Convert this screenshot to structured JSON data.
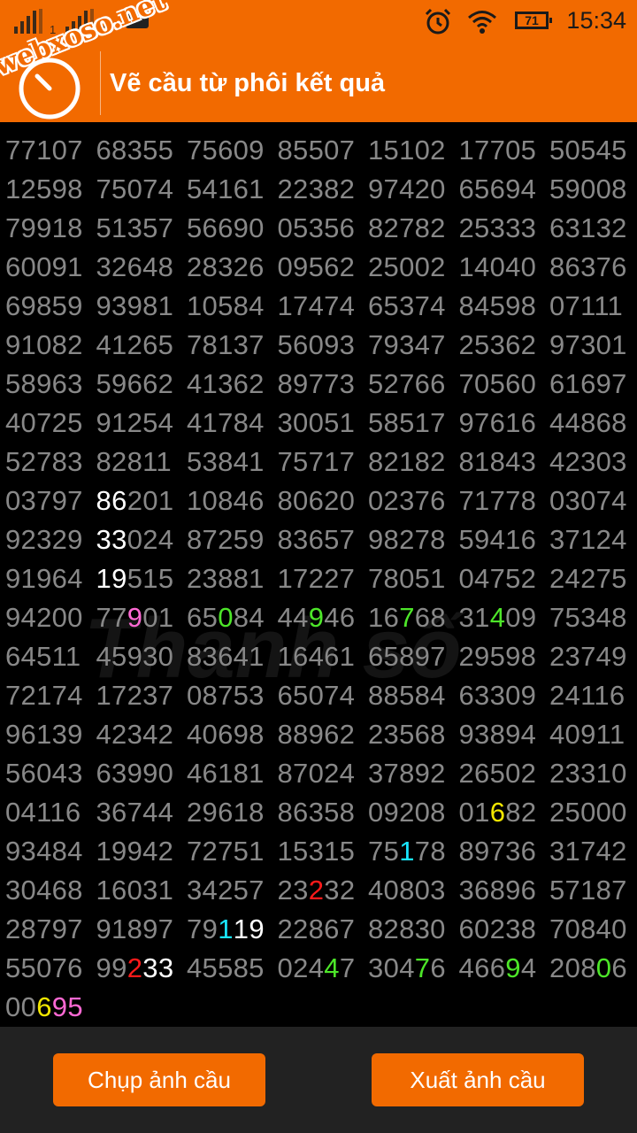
{
  "status_bar": {
    "sim1_label": "1",
    "sim2_label": "2",
    "battery": "71",
    "time": "15:34",
    "watermark": "webxoso.net"
  },
  "app_bar": {
    "title": "Vẽ cầu từ phôi kết quả"
  },
  "background_watermark": "Thanh số",
  "colors": {
    "accent": "#f26a00",
    "digit": "#888888",
    "white": "#ffffff",
    "pink": "#ff69d4",
    "green": "#4de629",
    "yellow": "#f2e600",
    "cyan": "#19e6ff",
    "red": "#ff1a1a"
  },
  "grid": {
    "rows": [
      [
        "77107",
        "68355",
        "75609",
        "85507",
        "15102",
        "17705",
        "50545"
      ],
      [
        "12598",
        "75074",
        "54161",
        "22382",
        "97420",
        "65694",
        "59008"
      ],
      [
        "79918",
        "51357",
        "56690",
        "05356",
        "82782",
        "25333",
        "63132"
      ],
      [
        "60091",
        "32648",
        "28326",
        "09562",
        "25002",
        "14040",
        "86376"
      ],
      [
        "69859",
        "93981",
        "10584",
        "17474",
        "65374",
        "84598",
        "07111"
      ],
      [
        "91082",
        "41265",
        "78137",
        "56093",
        "79347",
        "25362",
        "97301"
      ],
      [
        "58963",
        "59662",
        "41362",
        "89773",
        "52766",
        "70560",
        "61697"
      ],
      [
        "40725",
        "91254",
        "41784",
        "30051",
        "58517",
        "97616",
        "44868"
      ],
      [
        "52783",
        "82811",
        "53841",
        "75717",
        "82182",
        "81843",
        "42303"
      ],
      [
        "03797",
        "86201",
        "10846",
        "80620",
        "02376",
        "71778",
        "03074"
      ],
      [
        "92329",
        "33024",
        "87259",
        "83657",
        "98278",
        "59416",
        "37124"
      ],
      [
        "91964",
        "19515",
        "23881",
        "17227",
        "78051",
        "04752",
        "24275"
      ],
      [
        "94200",
        "77901",
        "65084",
        "44946",
        "16768",
        "31409",
        "75348"
      ],
      [
        "64511",
        "45930",
        "83641",
        "16461",
        "65897",
        "29598",
        "23749"
      ],
      [
        "72174",
        "17237",
        "08753",
        "65074",
        "88584",
        "63309",
        "24116"
      ],
      [
        "96139",
        "42342",
        "40698",
        "88962",
        "23568",
        "93894",
        "40911"
      ],
      [
        "56043",
        "63990",
        "46181",
        "87024",
        "37892",
        "26502",
        "23310"
      ],
      [
        "04116",
        "36744",
        "29618",
        "86358",
        "09208",
        "01682",
        "25000"
      ],
      [
        "93484",
        "19942",
        "72751",
        "15315",
        "75178",
        "89736",
        "31742"
      ],
      [
        "30468",
        "16031",
        "34257",
        "23232",
        "40803",
        "36896",
        "57187"
      ],
      [
        "28797",
        "91897",
        "79119",
        "22867",
        "82830",
        "60238",
        "70840"
      ],
      [
        "55076",
        "99233",
        "45585",
        "02447",
        "30476",
        "46694",
        "20806"
      ],
      [
        "00695"
      ]
    ],
    "highlights": [
      {
        "r": 9,
        "c": 1,
        "d": 0,
        "color": "white"
      },
      {
        "r": 9,
        "c": 1,
        "d": 1,
        "color": "white"
      },
      {
        "r": 10,
        "c": 1,
        "d": 0,
        "color": "white"
      },
      {
        "r": 10,
        "c": 1,
        "d": 1,
        "color": "white"
      },
      {
        "r": 11,
        "c": 1,
        "d": 0,
        "color": "white"
      },
      {
        "r": 11,
        "c": 1,
        "d": 1,
        "color": "white"
      },
      {
        "r": 12,
        "c": 1,
        "d": 2,
        "color": "pink"
      },
      {
        "r": 12,
        "c": 2,
        "d": 2,
        "color": "green"
      },
      {
        "r": 12,
        "c": 3,
        "d": 2,
        "color": "green"
      },
      {
        "r": 12,
        "c": 4,
        "d": 2,
        "color": "green"
      },
      {
        "r": 12,
        "c": 5,
        "d": 2,
        "color": "green"
      },
      {
        "r": 17,
        "c": 5,
        "d": 2,
        "color": "yellow"
      },
      {
        "r": 18,
        "c": 4,
        "d": 2,
        "color": "cyan"
      },
      {
        "r": 19,
        "c": 3,
        "d": 2,
        "color": "red"
      },
      {
        "r": 20,
        "c": 2,
        "d": 2,
        "color": "cyan"
      },
      {
        "r": 20,
        "c": 2,
        "d": 3,
        "color": "white"
      },
      {
        "r": 20,
        "c": 2,
        "d": 4,
        "color": "white"
      },
      {
        "r": 21,
        "c": 1,
        "d": 2,
        "color": "red"
      },
      {
        "r": 21,
        "c": 1,
        "d": 3,
        "color": "white"
      },
      {
        "r": 21,
        "c": 1,
        "d": 4,
        "color": "white"
      },
      {
        "r": 21,
        "c": 3,
        "d": 3,
        "color": "green"
      },
      {
        "r": 21,
        "c": 4,
        "d": 3,
        "color": "green"
      },
      {
        "r": 21,
        "c": 5,
        "d": 3,
        "color": "green"
      },
      {
        "r": 21,
        "c": 6,
        "d": 3,
        "color": "green"
      },
      {
        "r": 22,
        "c": 0,
        "d": 2,
        "color": "yellow"
      },
      {
        "r": 22,
        "c": 0,
        "d": 3,
        "color": "pink"
      },
      {
        "r": 22,
        "c": 0,
        "d": 4,
        "color": "pink"
      }
    ]
  },
  "footer": {
    "capture_label": "Chụp ảnh cầu",
    "export_label": "Xuất ảnh cầu"
  }
}
